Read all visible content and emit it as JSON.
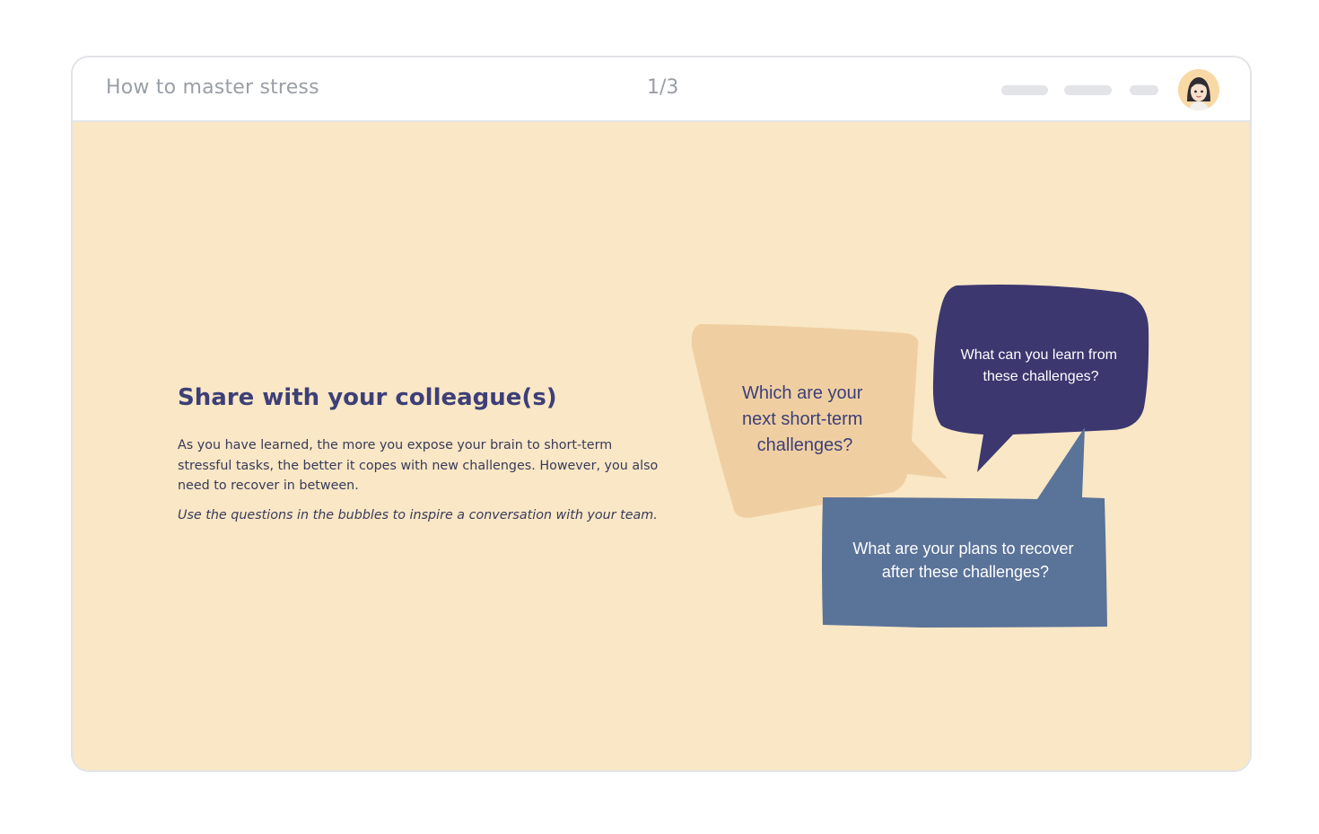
{
  "header": {
    "course_title": "How to master stress",
    "page_indicator": "1/3"
  },
  "slide": {
    "heading": "Share with your colleague(s)",
    "body": "As you have learned, the more you expose your brain to short-term stressful tasks, the better it copes with new challenges. However, you also need to recover in between.",
    "hint": "Use the questions in the bubbles to inspire a conversation with your team."
  },
  "bubbles": {
    "beige": {
      "line1": "Which are your",
      "line2": "next short-term",
      "line3": "challenges?",
      "color": "#efcfa2",
      "text_color": "#3d3f78"
    },
    "navy": {
      "line1": "What can you learn from",
      "line2": "these challenges?",
      "color": "#3c376f",
      "text_color": "#ffffff"
    },
    "slate": {
      "line1": "What are your plans to recover",
      "line2": "after these challenges?",
      "color": "#5a7399",
      "text_color": "#ffffff"
    }
  },
  "colors": {
    "background": "#f9e7c5",
    "heading": "#3d3f78",
    "body": "#393a5a"
  }
}
